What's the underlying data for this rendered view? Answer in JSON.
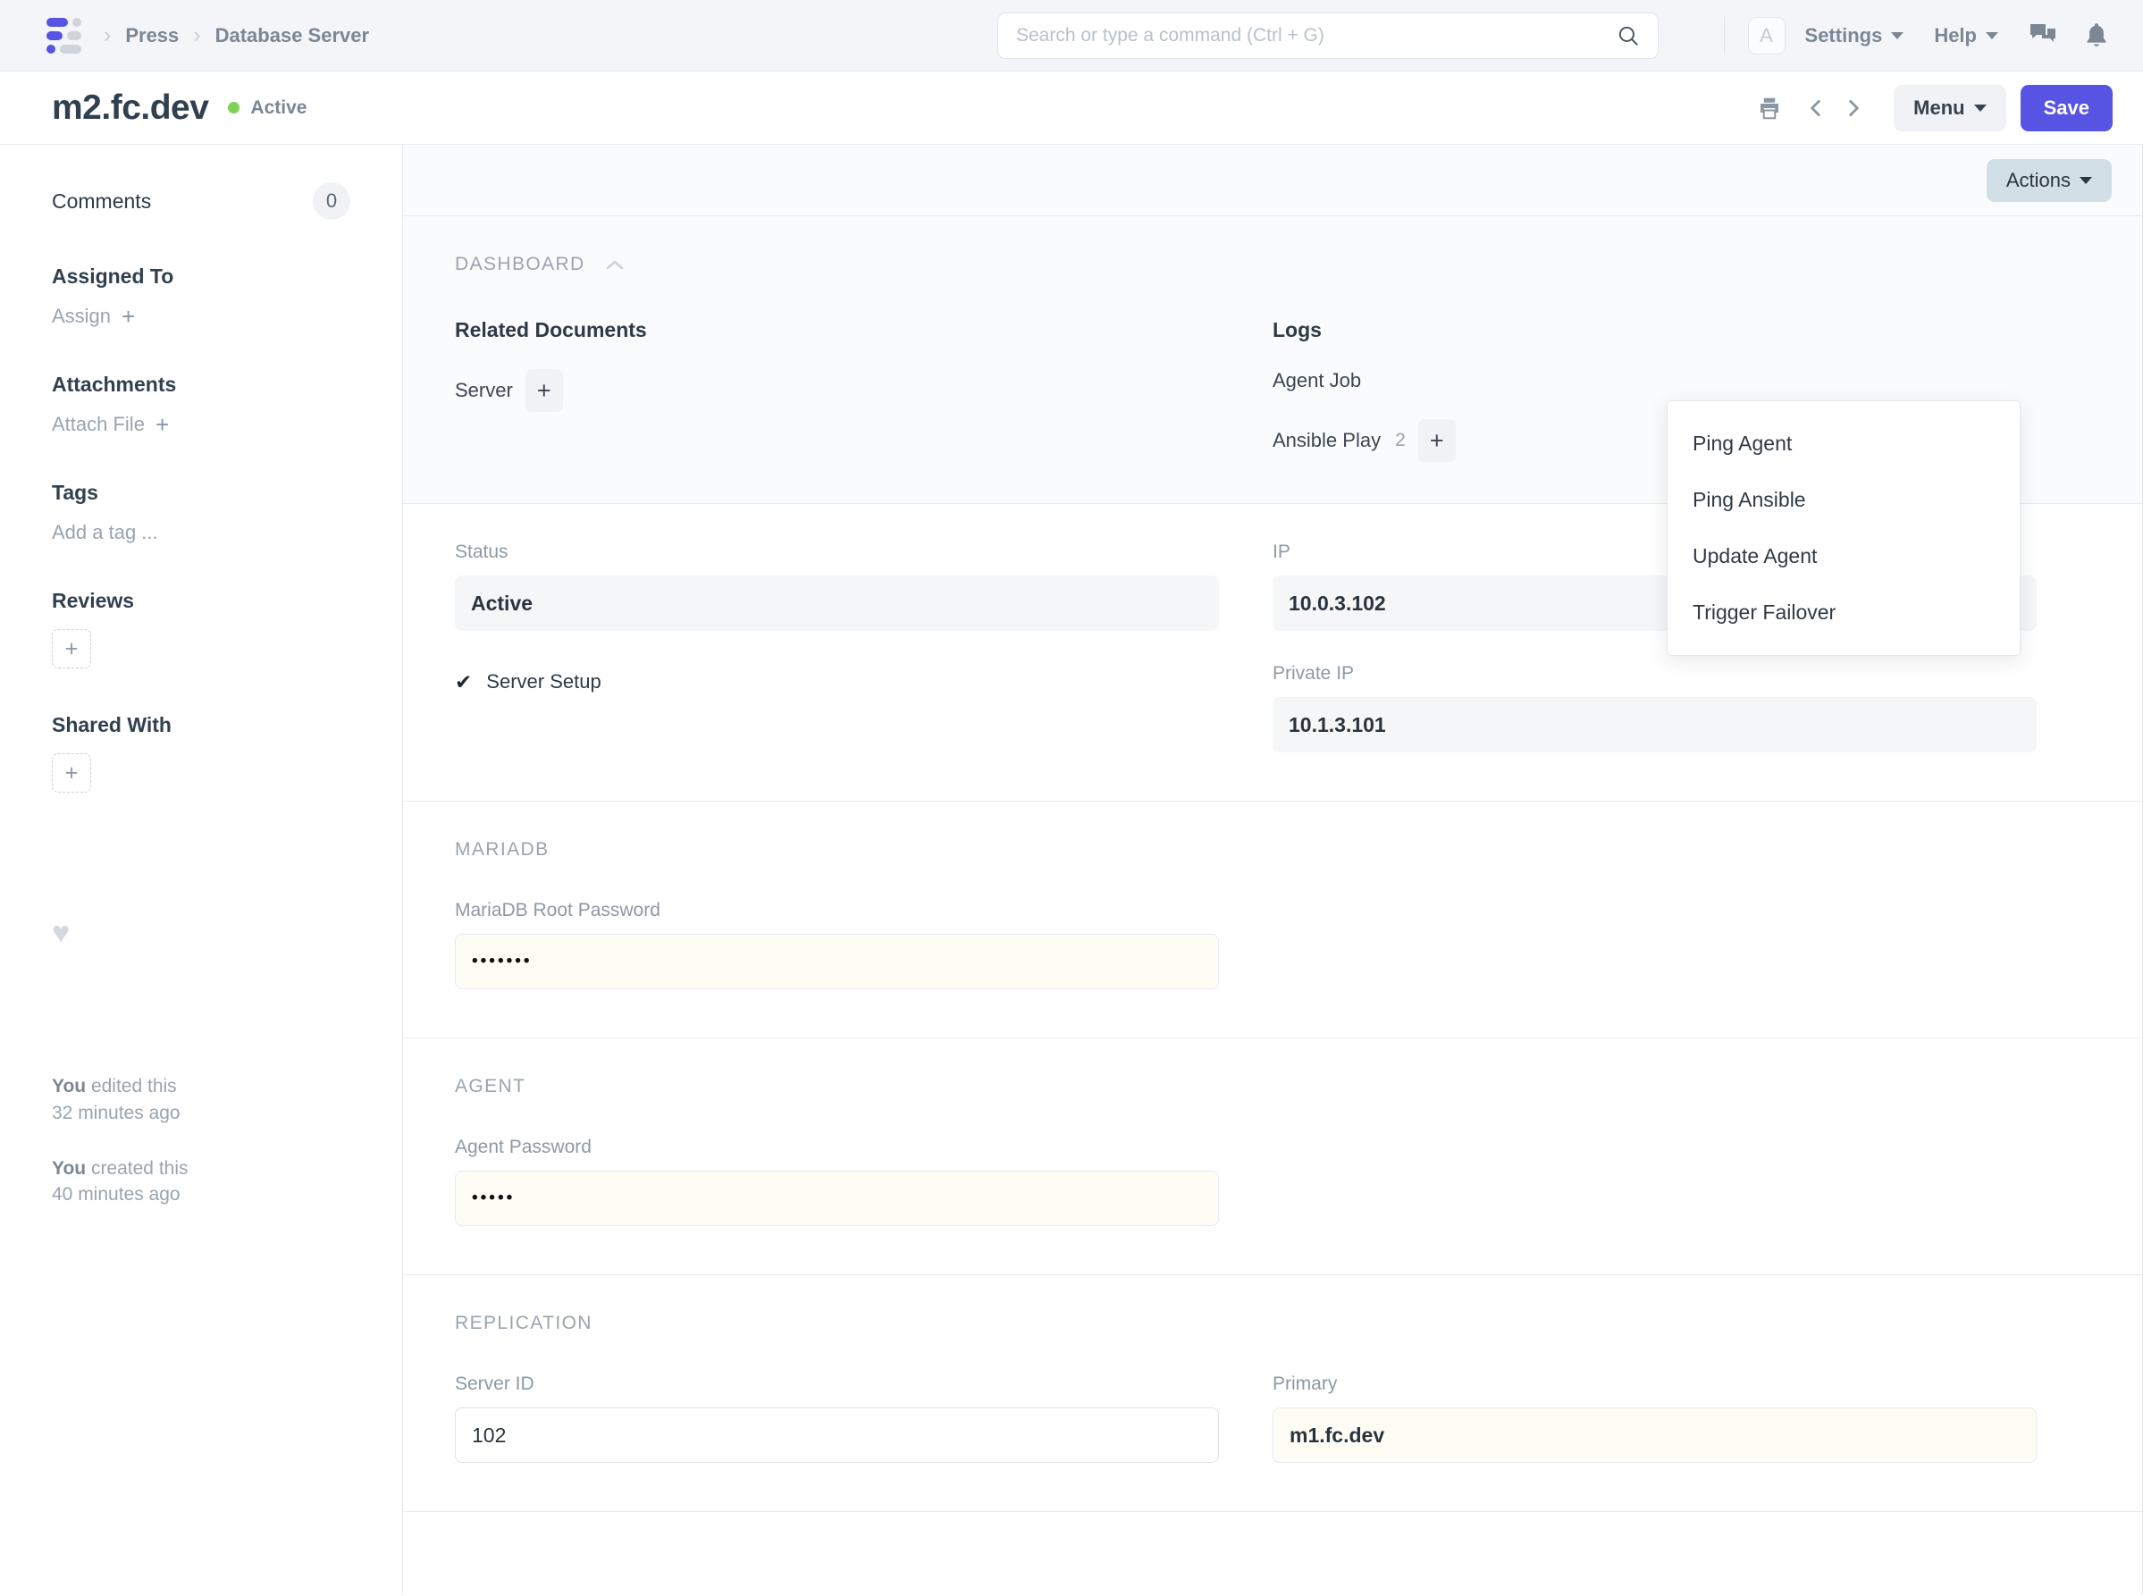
{
  "navbar": {
    "breadcrumbs": [
      "Press",
      "Database Server"
    ],
    "search": {
      "placeholder": "Search or type a command (Ctrl + G)",
      "value": ""
    },
    "avatar_letter": "A",
    "settings_label": "Settings",
    "help_label": "Help",
    "icons": [
      "search-icon",
      "chat-icon",
      "bell-icon"
    ]
  },
  "page": {
    "title": "m2.fc.dev",
    "status": "Active",
    "status_color": "#7fd155",
    "menu_label": "Menu",
    "save_label": "Save",
    "accent_color": "#5753e3"
  },
  "sidebar": {
    "comments_label": "Comments",
    "comments_count": "0",
    "assigned_to_label": "Assigned To",
    "assign_label": "Assign",
    "attachments_label": "Attachments",
    "attach_file_label": "Attach File",
    "tags_label": "Tags",
    "add_tag_label": "Add a tag ...",
    "reviews_label": "Reviews",
    "shared_with_label": "Shared With",
    "activity": [
      {
        "actor": "You",
        "action": " edited this",
        "time": "32 minutes ago"
      },
      {
        "actor": "You",
        "action": " created this",
        "time": "40 minutes ago"
      }
    ]
  },
  "content": {
    "actions_label": "Actions",
    "actions_menu": [
      "Ping Agent",
      "Ping Ansible",
      "Update Agent",
      "Trigger Failover"
    ],
    "dashboard": {
      "section_title": "DASHBOARD",
      "related_documents_label": "Related Documents",
      "related_documents": [
        {
          "label": "Server",
          "count": ""
        }
      ],
      "logs_label": "Logs",
      "logs": [
        {
          "label": "Agent Job",
          "count": ""
        },
        {
          "label": "Ansible Play",
          "count": "2"
        }
      ]
    },
    "status_section": {
      "status_label": "Status",
      "status_value": "Active",
      "server_setup_label": "Server Setup",
      "server_setup_checked": true,
      "ip_label": "IP",
      "ip_value": "10.0.3.102",
      "private_ip_label": "Private IP",
      "private_ip_value": "10.1.3.101"
    },
    "mariadb": {
      "section_title": "MARIADB",
      "root_password_label": "MariaDB Root Password",
      "root_password_value": "•••••••"
    },
    "agent": {
      "section_title": "AGENT",
      "agent_password_label": "Agent Password",
      "agent_password_value": "•••••"
    },
    "replication": {
      "section_title": "REPLICATION",
      "server_id_label": "Server ID",
      "server_id_value": "102",
      "primary_label": "Primary",
      "primary_value": "m1.fc.dev"
    }
  }
}
